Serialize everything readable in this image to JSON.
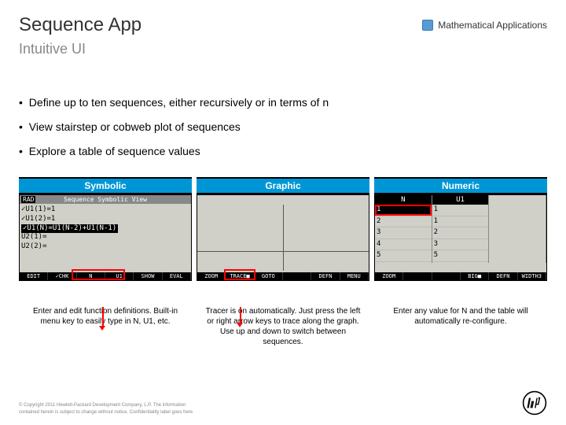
{
  "header": {
    "title": "Sequence App",
    "category": "Mathematical Applications",
    "subtitle": "Intuitive UI"
  },
  "bullets": [
    "Define up to ten sequences, either recursively or in terms of n",
    "View stairstep or cobweb plot of sequences",
    "Explore a table of sequence values"
  ],
  "panels": {
    "symbolic": {
      "title": "Symbolic",
      "top_left": "RAD",
      "top_center": "Sequence Symbolic View",
      "lines": [
        "✓U1(1)=1",
        "✓U1(2)=1",
        "✓U1(N)=U1(N-2)+U1(N-1)",
        " U2(1)=",
        " U2(2)="
      ],
      "buttons": [
        "EDIT",
        "✓CHK",
        "N",
        "U1",
        "SHOW",
        "EVAL"
      ]
    },
    "graphic": {
      "title": "Graphic",
      "buttons": [
        "ZOOM",
        "TRACE■",
        "GOTO",
        "",
        "DEFN",
        "MENU"
      ]
    },
    "numeric": {
      "title": "Numeric",
      "col1_head": "N",
      "col2_head": "U1",
      "col1": [
        "1",
        "2",
        "3",
        "4",
        "5"
      ],
      "col2": [
        "1",
        "1",
        "2",
        "3",
        "5"
      ],
      "buttons": [
        "ZOOM",
        "",
        "",
        "BIG■",
        "DEFN",
        "WIDTH3"
      ]
    }
  },
  "captions": {
    "symbolic": "Enter and edit function definitions. Built-in menu key to easily type in N, U1, etc.",
    "graphic": "Tracer is on automatically.  Just press the left or right arrow keys to trace along the graph.  Use up and down to switch between sequences.",
    "numeric": "Enter any value for N and the table will automatically re-configure."
  },
  "footer": {
    "line1": "© Copyright 2011 Hewlett-Packard Development Company, L.P. The information",
    "line2": "contained herein is subject to change without notice. Confidentiality label goes here"
  }
}
